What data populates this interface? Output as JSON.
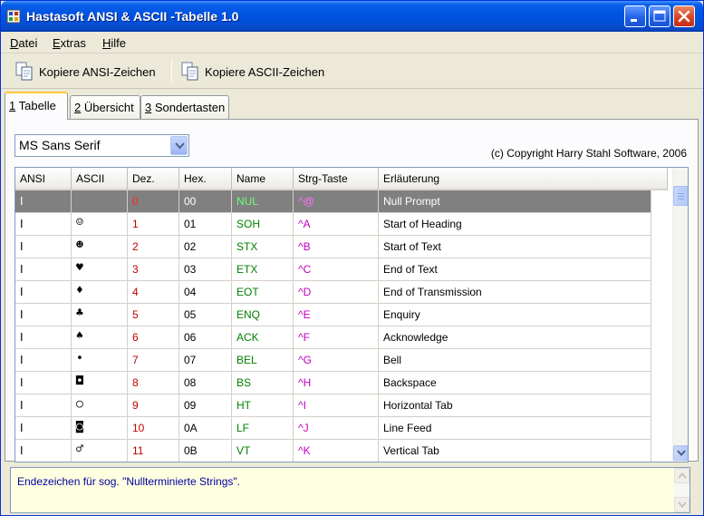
{
  "window": {
    "title": "Hastasoft ANSI & ASCII -Tabelle 1.0"
  },
  "menu": {
    "items": [
      {
        "label_u": "D",
        "label_rest": "atei"
      },
      {
        "label_u": "E",
        "label_rest": "xtras"
      },
      {
        "label_u": "H",
        "label_rest": "ilfe"
      }
    ]
  },
  "toolbar": {
    "copy_ansi_label": "Kopiere ANSI-Zeichen",
    "copy_ascii_label": "Kopiere ASCII-Zeichen"
  },
  "tabs": [
    {
      "num": "1",
      "label": " Tabelle"
    },
    {
      "num": "2",
      "label": " Übersicht"
    },
    {
      "num": "3",
      "label": " Sondertasten"
    }
  ],
  "font_select": {
    "value": "MS Sans Serif"
  },
  "copyright": "(c) Copyright Harry Stahl Software, 2006",
  "table": {
    "headers": [
      "ANSI",
      "ASCII",
      "Dez.",
      "Hex.",
      "Name",
      "Strg-Taste",
      "Erläuterung"
    ],
    "rows": [
      {
        "ansi": "I",
        "ascii": "",
        "dez": "0",
        "hex": "00",
        "name": "NUL",
        "strg": "^@",
        "desc": "Null Prompt"
      },
      {
        "ansi": "I",
        "ascii": "☺",
        "dez": "1",
        "hex": "01",
        "name": "SOH",
        "strg": "^A",
        "desc": "Start of Heading"
      },
      {
        "ansi": "I",
        "ascii": "☻",
        "dez": "2",
        "hex": "02",
        "name": "STX",
        "strg": "^B",
        "desc": "Start of Text"
      },
      {
        "ansi": "I",
        "ascii": "♥",
        "dez": "3",
        "hex": "03",
        "name": "ETX",
        "strg": "^C",
        "desc": "End of Text"
      },
      {
        "ansi": "I",
        "ascii": "♦",
        "dez": "4",
        "hex": "04",
        "name": "EOT",
        "strg": "^D",
        "desc": "End of Transmission"
      },
      {
        "ansi": "I",
        "ascii": "♣",
        "dez": "5",
        "hex": "05",
        "name": "ENQ",
        "strg": "^E",
        "desc": "Enquiry"
      },
      {
        "ansi": "I",
        "ascii": "♠",
        "dez": "6",
        "hex": "06",
        "name": "ACK",
        "strg": "^F",
        "desc": "Acknowledge"
      },
      {
        "ansi": "I",
        "ascii": "•",
        "dez": "7",
        "hex": "07",
        "name": "BEL",
        "strg": "^G",
        "desc": "Bell"
      },
      {
        "ansi": "I",
        "ascii": "◘",
        "dez": "8",
        "hex": "08",
        "name": "BS",
        "strg": "^H",
        "desc": "Backspace"
      },
      {
        "ansi": "I",
        "ascii": "○",
        "dez": "9",
        "hex": "09",
        "name": "HT",
        "strg": "^I",
        "desc": "Horizontal Tab"
      },
      {
        "ansi": "I",
        "ascii": "◙",
        "dez": "10",
        "hex": "0A",
        "name": "LF",
        "strg": "^J",
        "desc": "Line Feed"
      },
      {
        "ansi": "I",
        "ascii": "♂",
        "dez": "11",
        "hex": "0B",
        "name": "VT",
        "strg": "^K",
        "desc": "Vertical Tab"
      }
    ]
  },
  "status_text": "Endezeichen für sog. \"Nullterminierte Strings\".",
  "icons": {
    "app": "app-icon",
    "minimize": "minimize-icon",
    "maximize": "maximize-icon",
    "close": "close-icon",
    "copy": "copy-document-icon",
    "dropdown": "chevron-down-icon"
  },
  "colors": {
    "titlebar": "#0054e3",
    "selected_row": "#808080",
    "dez_text": "#c00000",
    "name_text": "#008000",
    "strg_text": "#c000c0",
    "memo_bg": "#ffffe1",
    "memo_text": "#0000a0"
  }
}
